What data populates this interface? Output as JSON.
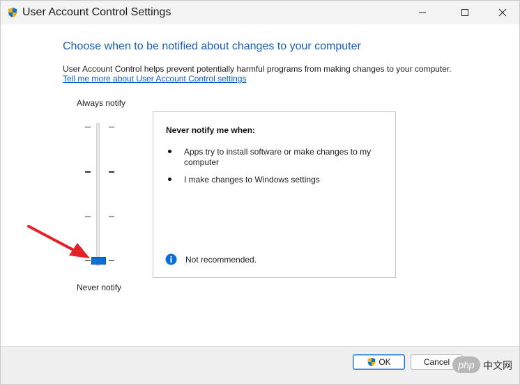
{
  "window": {
    "title": "User Account Control Settings",
    "controls": {
      "minimize": "minimize",
      "maximize": "maximize",
      "close": "close"
    }
  },
  "main": {
    "heading": "Choose when to be notified about changes to your computer",
    "description": "User Account Control helps prevent potentially harmful programs from making changes to your computer.",
    "learn_more_link": "Tell me more about User Account Control settings"
  },
  "slider": {
    "top_label": "Always notify",
    "bottom_label": "Never notify",
    "levels": 4,
    "selected_level": 1,
    "accent": "#0a6fd6"
  },
  "info": {
    "title": "Never notify me when:",
    "bullets": [
      "Apps try to install software or make changes to my computer",
      "I make changes to Windows settings"
    ],
    "recommendation": "Not recommended.",
    "recommendation_icon": "info-icon"
  },
  "annotation": {
    "arrow_color": "#e32126"
  },
  "footer": {
    "ok_label": "OK",
    "cancel_label": "Cancel"
  },
  "watermark": {
    "badge": "php",
    "text": "中文网"
  }
}
